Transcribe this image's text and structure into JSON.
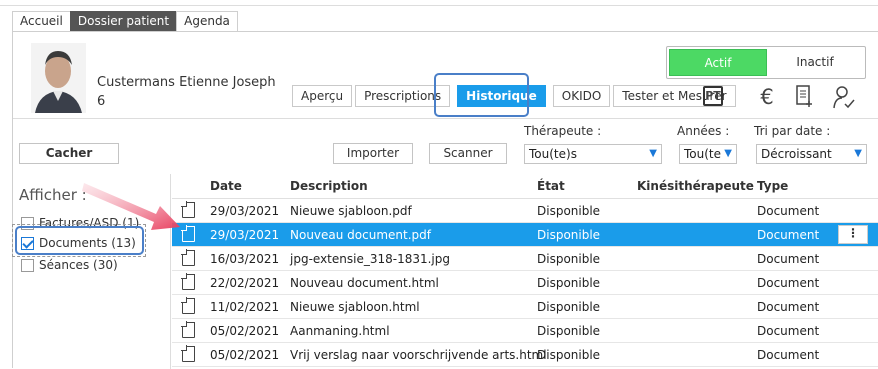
{
  "tabs": [
    {
      "label": "Accueil"
    },
    {
      "label": "Dossier patient"
    },
    {
      "label": "Agenda"
    }
  ],
  "patient": {
    "name": "Custermans Etienne Joseph",
    "number": "6"
  },
  "status": {
    "active": "Actif",
    "inactive": "Inactif",
    "active_color": "#4cd964"
  },
  "subtabs": [
    {
      "label": "Aperçu"
    },
    {
      "label": "Prescriptions"
    },
    {
      "label": "Historique"
    },
    {
      "label": "OKIDO"
    },
    {
      "label": "Tester et Mesurer"
    }
  ],
  "icons": {
    "pt": "PT",
    "euro": "€",
    "doc": "document-plus-icon",
    "person": "person-check-icon"
  },
  "toolbar": {
    "hide": "Cacher",
    "import": "Importer",
    "scan": "Scanner"
  },
  "filters": {
    "therapist_label": "Thérapeute :",
    "therapist_value": "Tou(te)s",
    "year_label": "Années :",
    "year_value": "Tou(te",
    "sort_label": "Tri par date :",
    "sort_value": "Décroissant"
  },
  "sidebar": {
    "title": "Afficher :",
    "items": [
      {
        "label": "Factures/ASD (1)",
        "checked": false
      },
      {
        "label": "Documents (13)",
        "checked": true
      },
      {
        "label": "Séances (30)",
        "checked": false
      }
    ]
  },
  "table": {
    "headers": [
      "Date",
      "Description",
      "État",
      "Kinésithérapeute",
      "Type"
    ],
    "rows": [
      {
        "date": "29/03/2021",
        "desc": "Nieuwe sjabloon.pdf",
        "state": "Disponible",
        "kine": "",
        "type": "Document"
      },
      {
        "date": "29/03/2021",
        "desc": "Nouveau document.pdf",
        "state": "Disponible",
        "kine": "",
        "type": "Document"
      },
      {
        "date": "16/03/2021",
        "desc": "jpg-extensie_318-1831.jpg",
        "state": "Disponible",
        "kine": "",
        "type": "Document"
      },
      {
        "date": "22/02/2021",
        "desc": "Nouveau document.html",
        "state": "Disponible",
        "kine": "",
        "type": "Document"
      },
      {
        "date": "11/02/2021",
        "desc": "Nieuwe sjabloon.html",
        "state": "Disponible",
        "kine": "",
        "type": "Document"
      },
      {
        "date": "05/02/2021",
        "desc": "Aanmaning.html",
        "state": "Disponible",
        "kine": "",
        "type": "Document"
      },
      {
        "date": "05/02/2021",
        "desc": "Vrij verslag naar voorschrijvende arts.html",
        "state": "Disponible",
        "kine": "",
        "type": "Document"
      }
    ]
  },
  "more_label": "⋮",
  "colors": {
    "accent": "#1a9cea",
    "highlight": "#4a7fc8",
    "arrow": "#e8405f"
  }
}
